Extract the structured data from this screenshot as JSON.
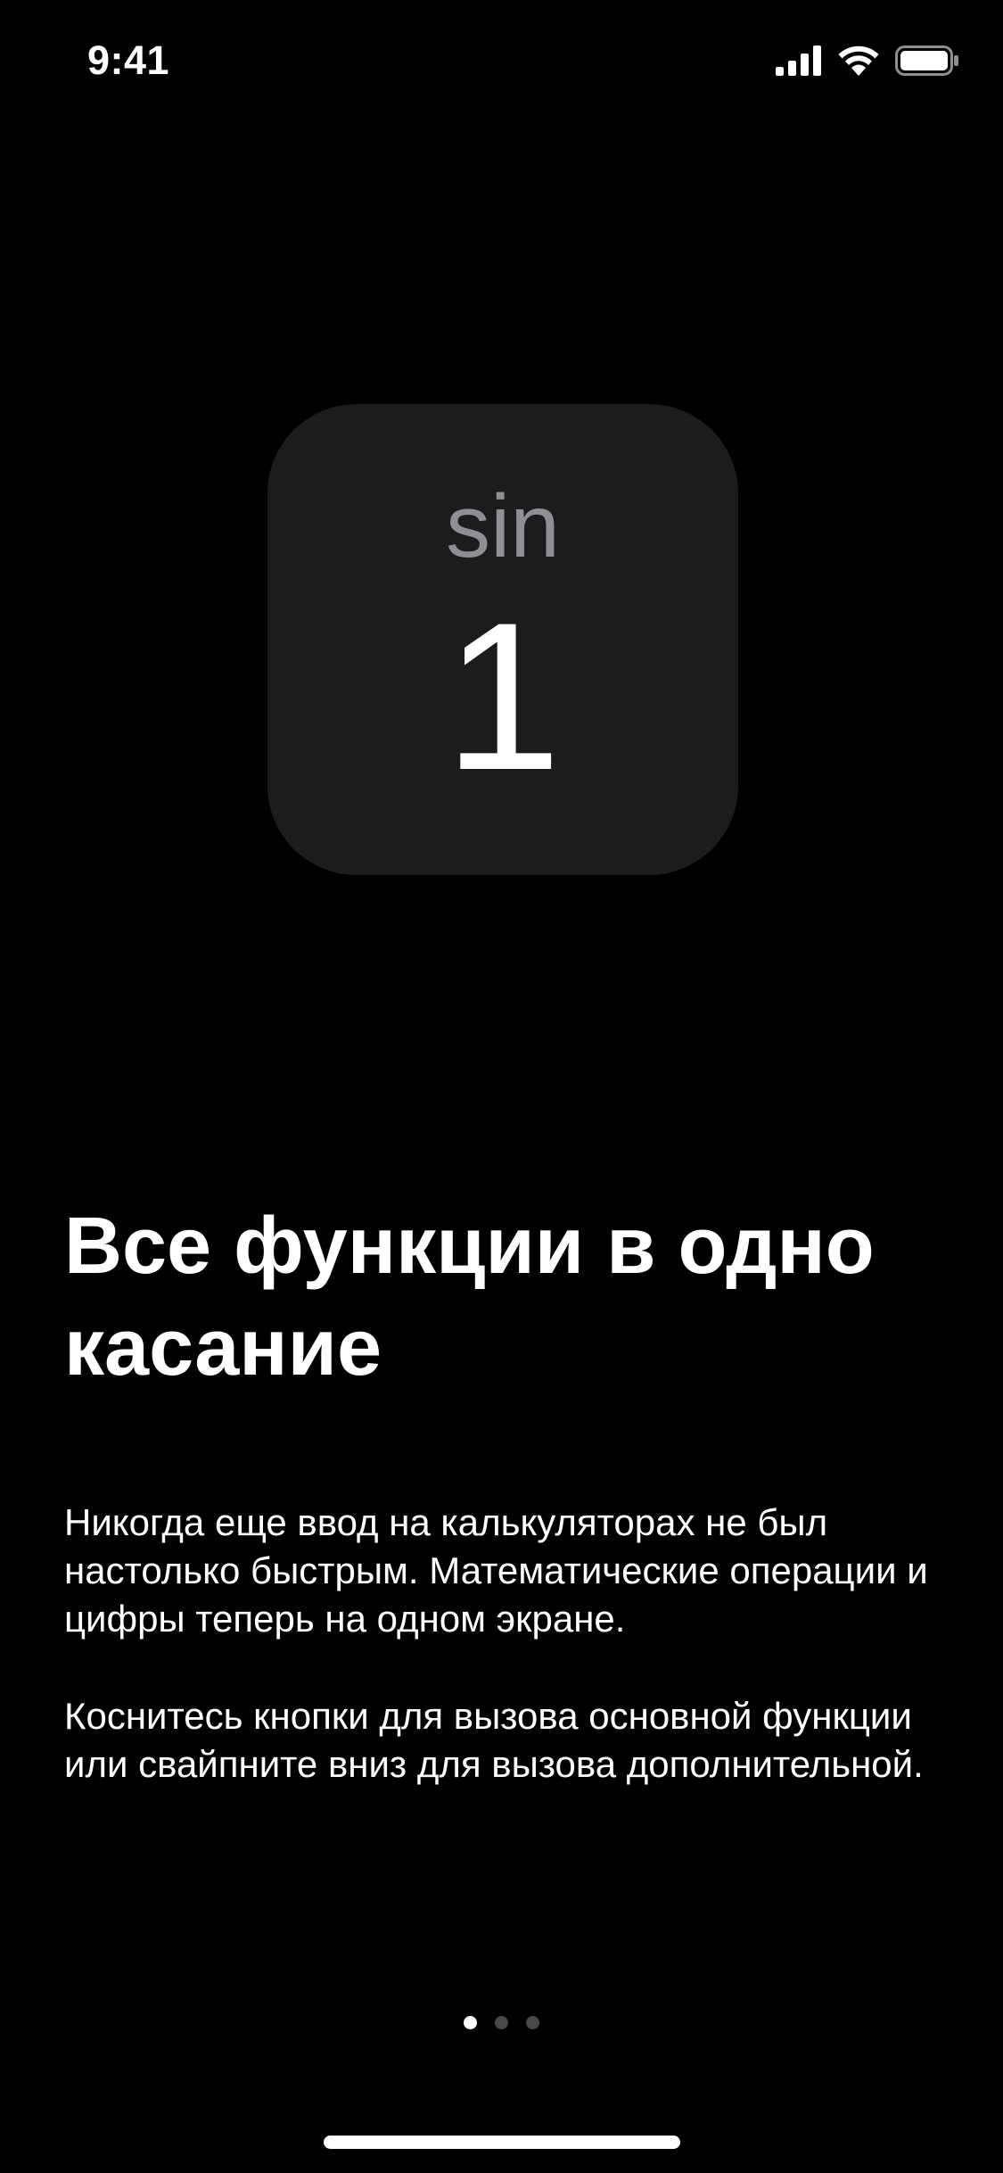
{
  "status_bar": {
    "time": "9:41",
    "icons": [
      "cellular-signal-icon",
      "wifi-icon",
      "battery-icon"
    ]
  },
  "key_preview": {
    "secondary_label": "sin",
    "primary_label": "1"
  },
  "onboarding": {
    "title": "Все функции в одно касание",
    "paragraphs": [
      "Никогда еще ввод на калькуляторах не был настолько быстрым. Математические операции и цифры теперь на одном экране.",
      "Коснитесь кнопки для вызова основной функции или свайпните вниз для вызова дополнительной."
    ]
  },
  "pagination": {
    "total_pages": 3,
    "current_page": 1
  },
  "colors": {
    "background": "#000000",
    "tile_background": "#1c1c1e",
    "secondary_text": "#8e8e93",
    "primary_text": "#ffffff",
    "inactive_dot": "#48484a"
  }
}
